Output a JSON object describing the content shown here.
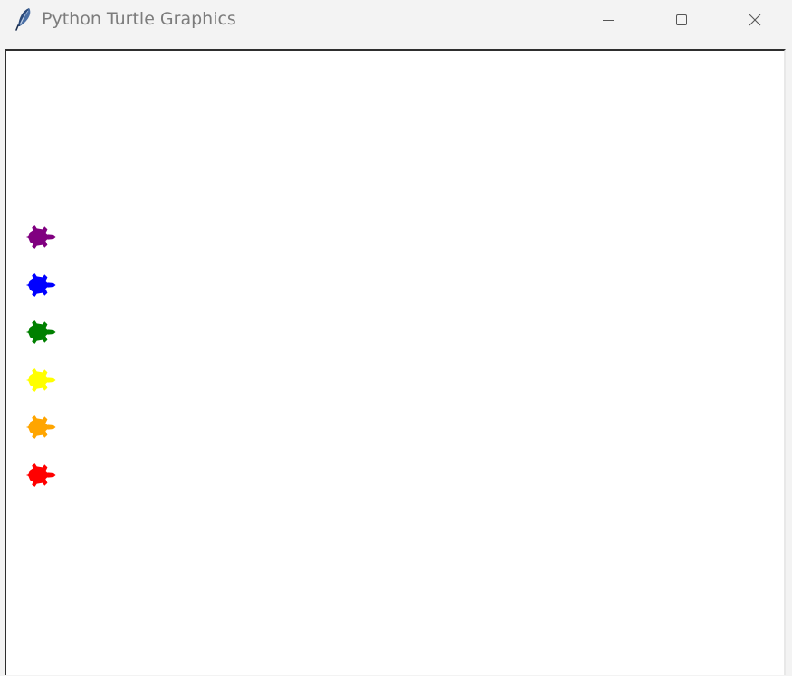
{
  "window": {
    "title": "Python Turtle Graphics",
    "app_icon": "feather-icon",
    "controls": {
      "minimize_icon": "minimize-icon",
      "maximize_icon": "maximize-icon",
      "close_icon": "close-icon"
    }
  },
  "canvas": {
    "background": "#ffffff",
    "turtles": [
      {
        "color": "purple",
        "hex": "#800080",
        "heading": "east"
      },
      {
        "color": "blue",
        "hex": "#0000ff",
        "heading": "east"
      },
      {
        "color": "green",
        "hex": "#008000",
        "heading": "east"
      },
      {
        "color": "yellow",
        "hex": "#ffff00",
        "heading": "east"
      },
      {
        "color": "orange",
        "hex": "#ffa500",
        "heading": "east"
      },
      {
        "color": "red",
        "hex": "#ff0000",
        "heading": "east"
      }
    ]
  }
}
